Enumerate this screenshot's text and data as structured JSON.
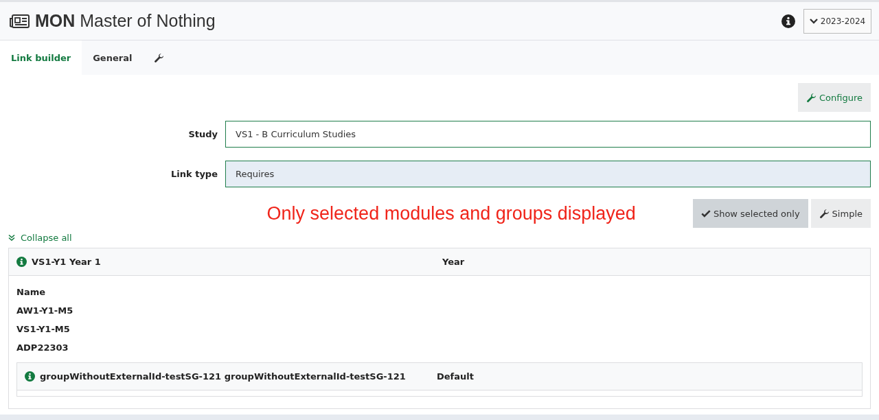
{
  "header": {
    "code": "MON",
    "title": "Master of Nothing",
    "year": "2023-2024"
  },
  "tabs": [
    {
      "kind": "text",
      "label": "Link builder",
      "selected": true
    },
    {
      "kind": "text",
      "label": "General",
      "selected": false
    },
    {
      "kind": "icon",
      "selected": false
    }
  ],
  "configure_button": "Configure",
  "form": [
    {
      "label": "Study",
      "value": "VS1 - B Curriculum Studies",
      "readonly": false
    },
    {
      "label": "Link type",
      "value": "Requires",
      "readonly": true
    }
  ],
  "message": "Only selected modules and groups displayed",
  "toolbar": [
    {
      "kind": "check",
      "label": "Show selected only",
      "pressed": true
    },
    {
      "kind": "wrench",
      "label": "Simple",
      "pressed": false
    }
  ],
  "collapse_all": "Collapse all",
  "panel": {
    "title": "VS1-Y1 Year 1",
    "type": "Year",
    "modules_heading": "Name",
    "modules": [
      "AW1-Y1-M5",
      "VS1-Y1-M5",
      "ADP22303"
    ],
    "group": {
      "title": "groupWithoutExternalId-testSG-121 groupWithoutExternalId-testSG-121",
      "type": "Default"
    }
  }
}
